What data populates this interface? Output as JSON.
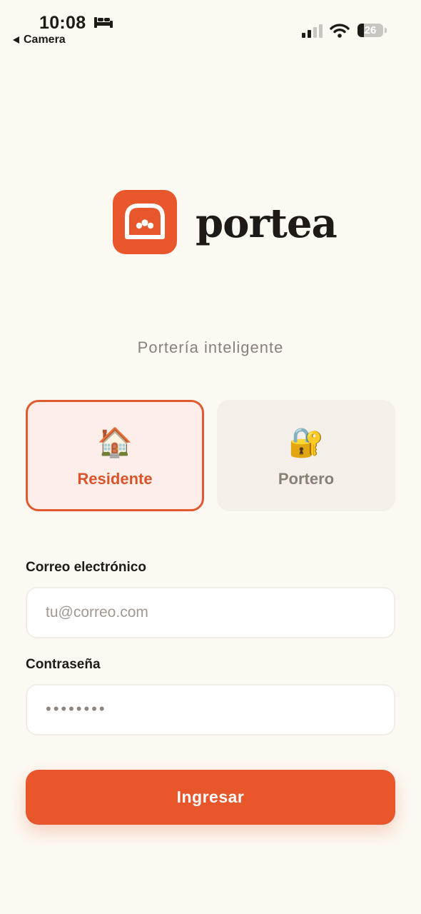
{
  "status_bar": {
    "time": "10:08",
    "back_label": "Camera",
    "battery_level": "26",
    "battery_fraction": 0.26
  },
  "brand": {
    "name": "portea",
    "tagline": "Portería inteligente",
    "accent_color": "#e8572c",
    "icon": "door-bell-icon"
  },
  "roles": [
    {
      "label": "Residente",
      "emoji": "🏠",
      "icon": "house-icon",
      "selected": true
    },
    {
      "label": "Portero",
      "emoji": "🔐",
      "icon": "lock-key-icon",
      "selected": false
    }
  ],
  "form": {
    "email": {
      "label": "Correo electrónico",
      "placeholder": "tu@correo.com",
      "value": ""
    },
    "password": {
      "label": "Contraseña",
      "placeholder": "••••••••",
      "value": ""
    },
    "submit_label": "Ingresar"
  }
}
